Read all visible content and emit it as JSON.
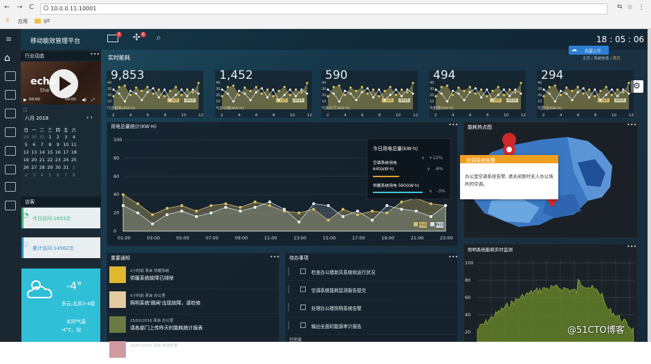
{
  "browser": {
    "url": "10.0.0.11:10001",
    "bookmarks": [
      "应用",
      "git"
    ]
  },
  "app": {
    "title": "移动能效管理平台",
    "time": "18 : 05 : 06",
    "mail_badge": "3",
    "alert_badge": "9"
  },
  "breadcrumb": {
    "cloud_label": "我要上传",
    "items": [
      "主页",
      "系统信息",
      "首页"
    ]
  },
  "left": {
    "news_title": "行业动态",
    "video_text": "echo",
    "video_sub": "the life",
    "video_time_start": "00:00",
    "video_time_end": "00:00",
    "calendar": {
      "month": "八月 2018",
      "weekdays": [
        "日",
        "一",
        "二",
        "三",
        "四",
        "五",
        "六"
      ],
      "rows": [
        [
          "29",
          "30",
          "31",
          "1",
          "2",
          "3",
          "4"
        ],
        [
          "5",
          "6",
          "7",
          "8",
          "9",
          "10",
          "11"
        ],
        [
          "12",
          "13",
          "14",
          "15",
          "16",
          "17",
          "18"
        ],
        [
          "19",
          "20",
          "21",
          "22",
          "23",
          "24",
          "25"
        ],
        [
          "26",
          "27",
          "28",
          "29",
          "30",
          "31",
          "1"
        ],
        [
          "2",
          "3",
          "4",
          "5",
          "6",
          "7",
          "8"
        ]
      ],
      "dim_first": 3,
      "dim_last": 8
    },
    "visits_title": "访客",
    "today_visits": "今日访问:1893次",
    "total_visits": "累计访问:14562次",
    "weather": {
      "temp": "-4°",
      "desc": "多云,北风3-4级",
      "label": "实时气温",
      "value": "-4°C，较"
    }
  },
  "section_title": "实时能耗",
  "kpis": [
    {
      "value": "9,853",
      "unit": "(总能耗/KW·H)",
      "legend": [
        "2016",
        "2015"
      ]
    },
    {
      "value": "1,452",
      "unit": "(办公楼/KW·H)",
      "legend": [
        "2016",
        "2015"
      ]
    },
    {
      "value": "590",
      "unit": "(商业厅/KW·H)",
      "legend": [
        "2016",
        "2015"
      ]
    },
    {
      "value": "494",
      "unit": "(机房/KW·H)",
      "legend": [
        "2016",
        "2015"
      ]
    },
    {
      "value": "294",
      "unit": "(其他/KW·H)",
      "legend": [
        "2016",
        "2015"
      ]
    }
  ],
  "kpi_axis": {
    "y": [
      "40",
      "30",
      "20",
      "10",
      "0"
    ],
    "x": [
      "2",
      "4",
      "6",
      "8",
      "10",
      "12"
    ]
  },
  "main_chart": {
    "title": "用电总量统计(KW·H)",
    "tooltip": {
      "title": "今日用电总量(kW·h)",
      "rows": [
        {
          "name": "空调系统用电",
          "value": "640(kW·h)",
          "change": "+12%"
        },
        {
          "name": "",
          "value": "",
          "change": "-8%"
        },
        {
          "name": "供暖系统用电 560(kW·h)",
          "value": "",
          "change": "-3%"
        }
      ]
    },
    "legend": [
      "今日",
      "昨日"
    ]
  },
  "chart_data": {
    "type": "area",
    "categories": [
      "01:00",
      "02:00",
      "03:00",
      "04:00",
      "05:00",
      "06:00",
      "07:00",
      "08:00",
      "09:00",
      "10:00",
      "11:00",
      "12:00",
      "13:00",
      "14:00",
      "15:00",
      "16:00",
      "17:00",
      "18:00",
      "19:00",
      "20:00",
      "21:00",
      "22:00",
      "23:00"
    ],
    "x_ticks": [
      "01:00",
      "03:00",
      "05:00",
      "07:00",
      "09:00",
      "11:00",
      "13:00",
      "15:00",
      "17:00",
      "19:00",
      "21:00",
      "23:00"
    ],
    "ylim": [
      0,
      100
    ],
    "yticks": [
      "0",
      "20",
      "40",
      "60",
      "80",
      "100"
    ],
    "series": [
      {
        "name": "今日",
        "color": "#d8c070",
        "values": [
          40,
          30,
          18,
          25,
          28,
          22,
          28,
          30,
          26,
          32,
          28,
          22,
          20,
          24,
          12,
          24,
          18,
          22,
          20,
          32,
          36,
          30,
          28
        ]
      },
      {
        "name": "昨日",
        "color": "#cfe2ec",
        "values": [
          28,
          20,
          8,
          18,
          22,
          16,
          20,
          26,
          22,
          26,
          32,
          24,
          10,
          30,
          28,
          16,
          22,
          12,
          28,
          24,
          22,
          16,
          28
        ]
      }
    ]
  },
  "heatmap": {
    "title": "能耗热点图",
    "popup_title": "空调系统告警",
    "popup_text": "办公室空调系统告警, 请关闭暂时无人办公场所的空调。"
  },
  "notice": {
    "title": "重要通知",
    "items": [
      {
        "meta": "2小时前 来自 供暖系统",
        "text": "供暖系统故障已排除"
      },
      {
        "meta": "5小时前 来自 办公室",
        "text": "照明系统'跳闸'出现故障，请检修"
      },
      {
        "meta": "25/02/2016 来自 办公室",
        "text": "请各部门上传昨天的能耗统计报表"
      },
      {
        "meta": "26/02/2016 来自 自动处理",
        "text": ""
      }
    ]
  },
  "todo": {
    "title": "待办事项",
    "items": [
      "检查办公楼新风系统和运行状况",
      "空调系统能耗监测报告提交",
      "处理办公楼照明系统告警",
      "输出全面的能源审计报告"
    ],
    "footer": "已完成"
  },
  "lighting": {
    "title": "照明系统能耗实时监测",
    "yticks": [
      "100",
      "80",
      "60",
      "40",
      "20"
    ]
  },
  "watermark": "@51CTO博客"
}
